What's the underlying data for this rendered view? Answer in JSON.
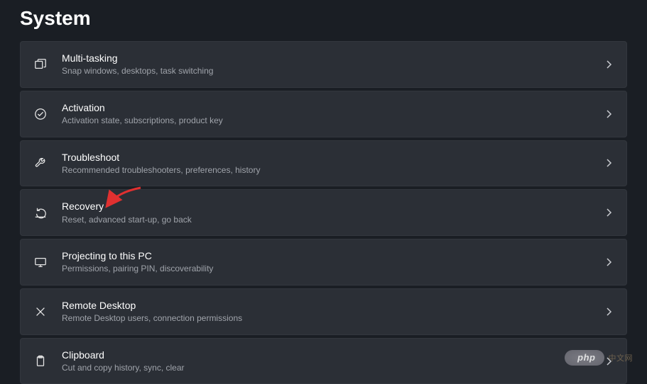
{
  "page_title": "System",
  "items": [
    {
      "title": "Multi-tasking",
      "subtitle": "Snap windows, desktops, task switching"
    },
    {
      "title": "Activation",
      "subtitle": "Activation state, subscriptions, product key"
    },
    {
      "title": "Troubleshoot",
      "subtitle": "Recommended troubleshooters, preferences, history"
    },
    {
      "title": "Recovery",
      "subtitle": "Reset, advanced start-up, go back"
    },
    {
      "title": "Projecting to this PC",
      "subtitle": "Permissions, pairing PIN, discoverability"
    },
    {
      "title": "Remote Desktop",
      "subtitle": "Remote Desktop users, connection permissions"
    },
    {
      "title": "Clipboard",
      "subtitle": "Cut and copy history, sync, clear"
    }
  ],
  "watermark": {
    "pill": "php",
    "suffix": "中文网"
  }
}
